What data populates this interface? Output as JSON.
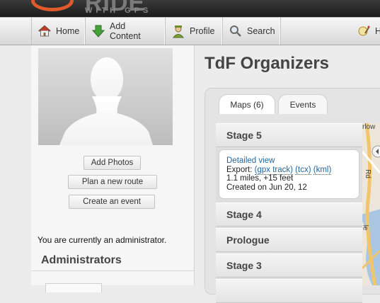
{
  "brand": {
    "logo_text": "RIDE",
    "logo_subtitle": "WITH GPS"
  },
  "nav": {
    "items": [
      {
        "label": "Home",
        "icon": "home-icon"
      },
      {
        "label": "Add Content",
        "icon": "add-arrow-icon"
      },
      {
        "label": "Profile",
        "icon": "profile-icon"
      },
      {
        "label": "Search",
        "icon": "search-icon"
      },
      {
        "label": "He",
        "icon": "help-icon"
      }
    ]
  },
  "sidebar": {
    "buttons": {
      "add_photos": "Add Photos",
      "plan_route": "Plan a new route",
      "create_event": "Create an event"
    },
    "admin_note": "You are currently an administrator.",
    "administrators_heading": "Administrators"
  },
  "main": {
    "title": "TdF Organizers",
    "tabs": [
      {
        "label": "Maps (6)",
        "active": true
      },
      {
        "label": "Events",
        "active": false
      }
    ],
    "stages": [
      "Stage 5",
      "Stage 4",
      "Prologue",
      "Stage 3"
    ],
    "detail": {
      "view_link": "Detailed view",
      "export_label": "Export:",
      "export_gpx": "(gpx track)",
      "export_tcx": "(tcx)",
      "export_kml": "(kml)",
      "stats": "1.1 miles, +15 feet",
      "created": "Created on Jun 20, 12"
    }
  },
  "map": {
    "labels": [
      "rlow",
      "Rd",
      "le"
    ]
  },
  "colors": {
    "accent_link": "#22679e",
    "logo_orange": "#e05a2b",
    "map_road": "#f2c56b",
    "map_water": "#a9c6e2"
  }
}
